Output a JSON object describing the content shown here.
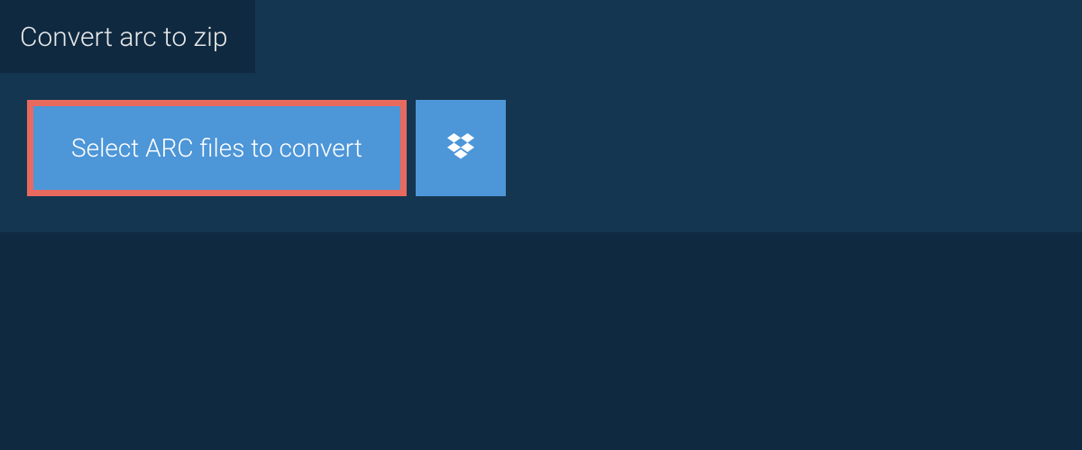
{
  "header": {
    "title": "Convert arc to zip"
  },
  "actions": {
    "select_label": "Select ARC files to convert"
  },
  "colors": {
    "background": "#0f2940",
    "panel": "#153650",
    "accent": "#4d96d8",
    "highlight_border": "#e86a5f"
  }
}
